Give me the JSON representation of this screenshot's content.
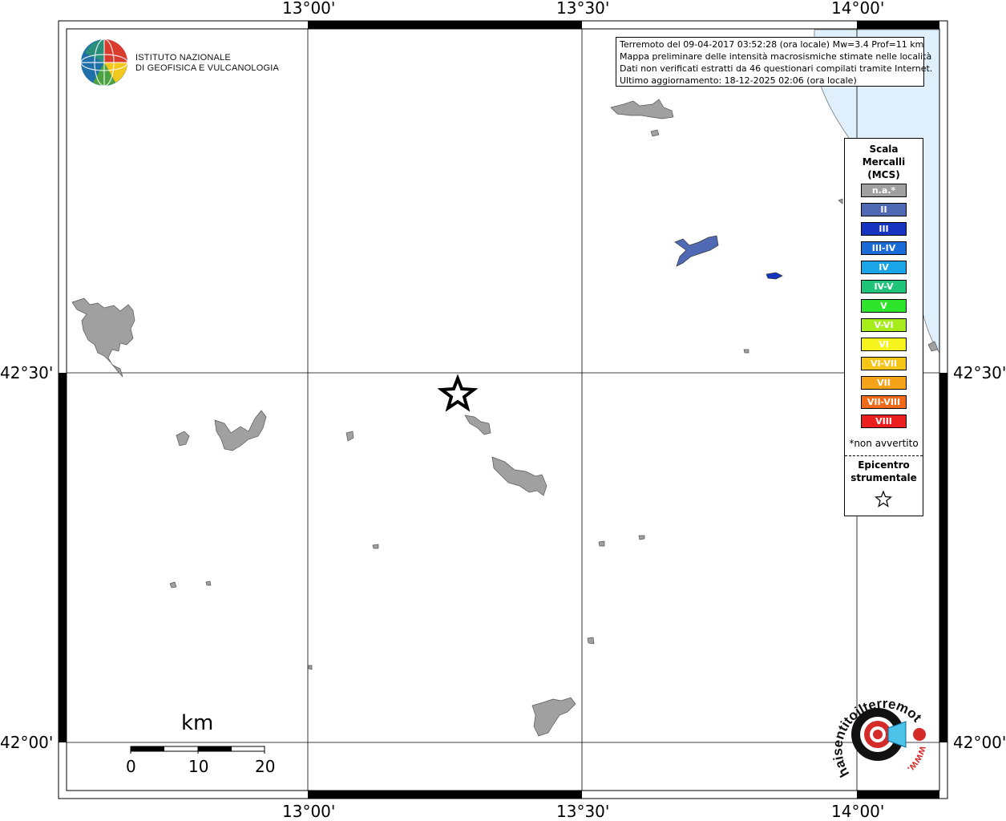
{
  "header_logo": {
    "line1": "ISTITUTO NAZIONALE",
    "line2": "DI GEOFISICA E VULCANOLOGIA",
    "icon": "ingv-globe-icon"
  },
  "info": {
    "line1": "Terremoto del 09-04-2017 03:52:28 (ora locale) Mw=3.4 Prof=11 km",
    "line2": "Mappa preliminare delle intensità macrosismiche stimate nelle località",
    "line3": "Dati non verificati estratti da 46 questionari compilati tramite Internet.",
    "line4": "Ultimo aggiornamento: 18-12-2025 02:06 (ora locale)"
  },
  "axes": {
    "lon_ticks": [
      "13°00'",
      "13°30'",
      "14°00'"
    ],
    "lat_ticks": [
      "42°30'",
      "42°00'"
    ]
  },
  "legend": {
    "title1": "Scala",
    "title2": "Mercalli",
    "title3": "(MCS)",
    "items": [
      {
        "label": "n.a.*",
        "color": "#a0a0a0"
      },
      {
        "label": "II",
        "color": "#5069b5"
      },
      {
        "label": "III",
        "color": "#1535c0"
      },
      {
        "label": "III-IV",
        "color": "#1a6ad8"
      },
      {
        "label": "IV",
        "color": "#19a5e8"
      },
      {
        "label": "IV-V",
        "color": "#1fc47a"
      },
      {
        "label": "V",
        "color": "#2fe52c"
      },
      {
        "label": "V-VI",
        "color": "#a6ed1b"
      },
      {
        "label": "VI",
        "color": "#f6f31c"
      },
      {
        "label": "VI-VII",
        "color": "#f5c518"
      },
      {
        "label": "VII",
        "color": "#f5a318"
      },
      {
        "label": "VII-VIII",
        "color": "#f06a18"
      },
      {
        "label": "VIII",
        "color": "#ea1e1e"
      }
    ],
    "note": "*non avvertito",
    "epicenter1": "Epicentro",
    "epicenter2": "strumentale",
    "epicenter_icon": "star-outline-icon"
  },
  "scale_bar": {
    "unit": "km",
    "labels": [
      "0",
      "10",
      "20"
    ]
  },
  "watermark": {
    "text": "haisentitoilterremoto.it",
    "prefix": "www.",
    "icon": "seismograph-target-icon"
  },
  "colors": {
    "land_gray": "#a0a0a0",
    "sea": "#dfeffb",
    "intensity_II": "#5069b5",
    "intensity_III": "#1535c0"
  }
}
